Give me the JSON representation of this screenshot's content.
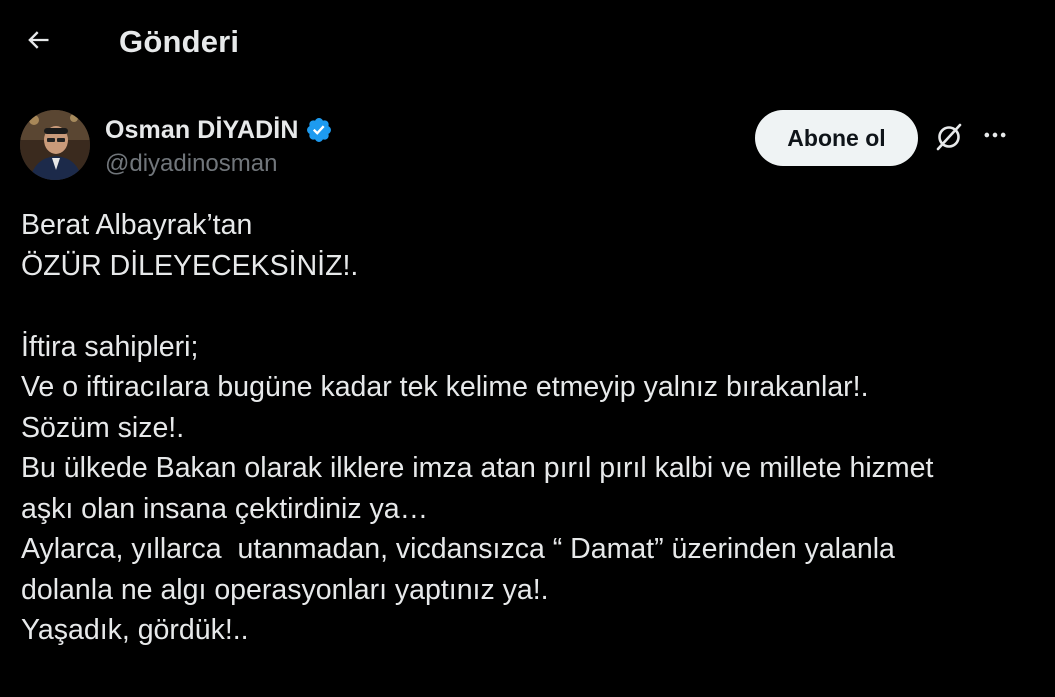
{
  "header": {
    "back_icon": "arrow-left-icon",
    "title": "Gönderi"
  },
  "author": {
    "name": "Osman DİYADİN",
    "handle": "@diyadinosman",
    "verified_icon": "verified-badge-icon",
    "verified_color": "#1d9bf0"
  },
  "actions": {
    "follow_label": "Abone ol",
    "grok_icon": "grok-icon",
    "more_icon": "more-horizontal-icon"
  },
  "tweet": {
    "lines": [
      "Berat Albayrak’tan",
      "ÖZÜR DİLEYECEKSİNİZ!.",
      "",
      "İftira sahipleri;",
      "Ve o iftiracılara bugüne kadar tek kelime etmeyip yalnız bırakanlar!.",
      "Sözüm size!.",
      "Bu ülkede Bakan olarak ilklere imza atan pırıl pırıl kalbi ve millete hizmet",
      "aşkı olan insana çektirdiniz ya…",
      "Aylarca, yıllarca  utanmadan, vicdansızca “ Damat” üzerinden yalanla",
      "dolanla ne algı operasyonları yaptınız ya!.",
      "Yaşadık, gördük!.."
    ]
  },
  "colors": {
    "background": "#000000",
    "text_primary": "#e7e9ea",
    "text_secondary": "#71767b",
    "button_bg": "#eff3f4",
    "button_text": "#0f1419"
  }
}
